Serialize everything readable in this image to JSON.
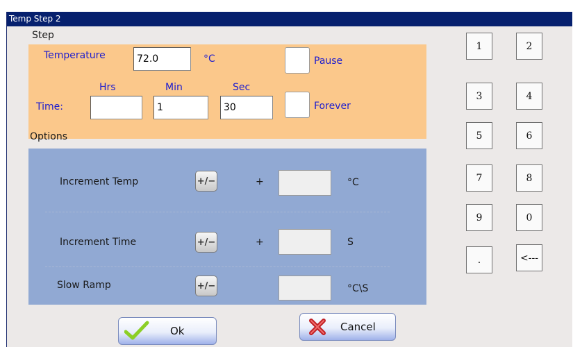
{
  "caption": "Temp Step 2 — top caption text (partially cut off)",
  "window": {
    "title": "Temp Step 2"
  },
  "step": {
    "section_label": "Step",
    "temperature_label": "Temperature",
    "temperature_value": "72.0",
    "temperature_unit": "°C",
    "pause_label": "Pause",
    "time_label": "Time:",
    "hrs_label": "Hrs",
    "min_label": "Min",
    "sec_label": "Sec",
    "hrs_value": "",
    "min_value": "1",
    "sec_value": "30",
    "forever_label": "Forever"
  },
  "options": {
    "section_label": "Options",
    "increment_temp": {
      "label": "Increment Temp",
      "sign": "+",
      "value": "",
      "unit": "°C",
      "toggle": "+/−"
    },
    "increment_time": {
      "label": "Increment Time",
      "sign": "+",
      "value": "",
      "unit": "S",
      "toggle": "+/−"
    },
    "slow_ramp": {
      "label": "Slow Ramp",
      "value": "",
      "unit": "°C\\S",
      "toggle": "+/−"
    }
  },
  "keypad": [
    "1",
    "2",
    "3",
    "4",
    "5",
    "6",
    "7",
    "8",
    "9",
    "0",
    ".",
    "<---"
  ],
  "buttons": {
    "ok": "Ok",
    "cancel": "Cancel"
  },
  "colors": {
    "titlebar": "#06206e",
    "step_panel": "#fbc88b",
    "options_panel": "#91a9d3",
    "window_bg": "#ece9e8"
  }
}
